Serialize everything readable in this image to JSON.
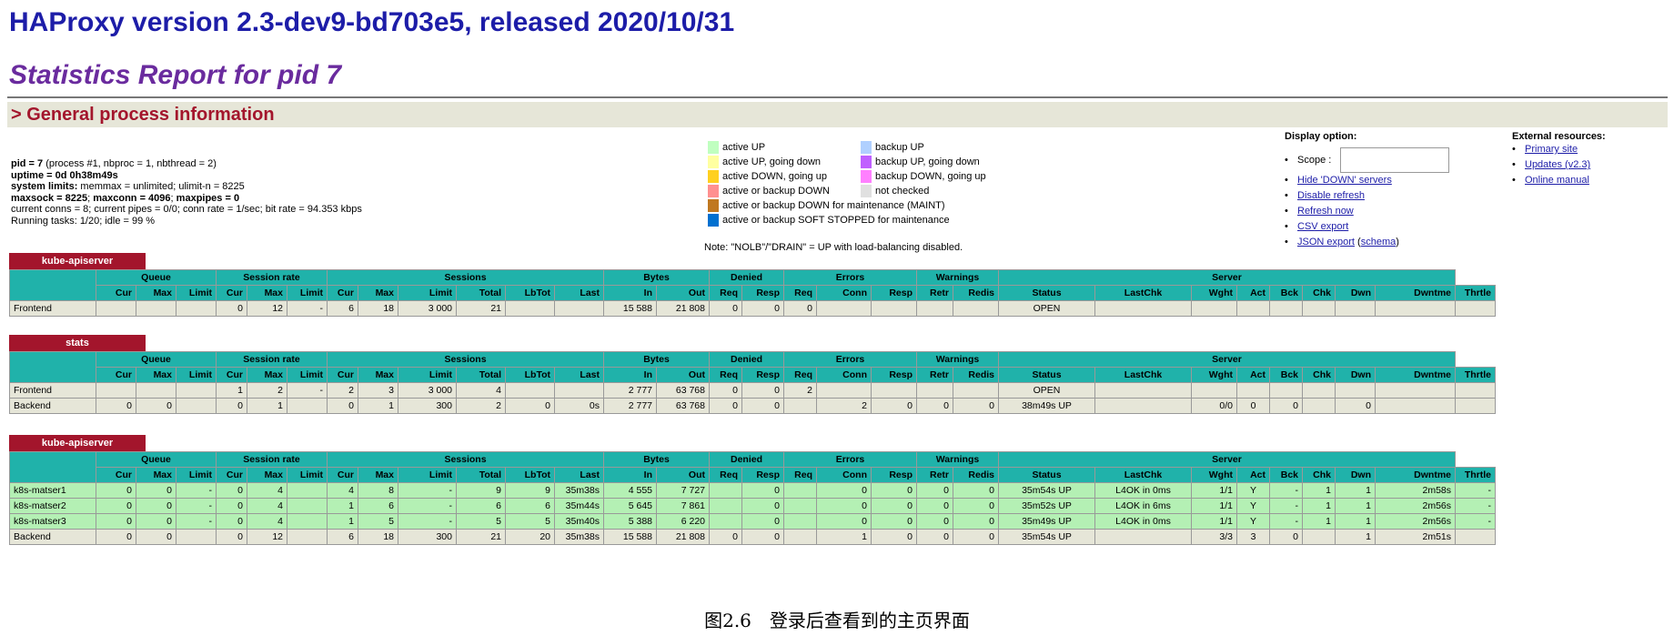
{
  "title": "HAProxy version 2.3-dev9-bd703e5, released 2020/10/31",
  "subtitle": "Statistics Report for pid 7",
  "section_title": "> General process information",
  "process_info": {
    "line1_key": "pid = 7",
    "line1_rest": " (process #1, nbproc = 1, nbthread = 2)",
    "line2_key": "uptime = 0d 0h38m49s",
    "line3_key": "system limits:",
    "line3_rest": " memmax = unlimited; ulimit-n = 8225",
    "line4_key1": "maxsock = 8225",
    "line4_sep1": "; ",
    "line4_key2": "maxconn = 4096",
    "line4_sep2": "; ",
    "line4_key3": "maxpipes = 0",
    "line5": "current conns = 8; current pipes = 0/0; conn rate = 1/sec; bit rate = 94.353 kbps",
    "line6": "Running tasks: 1/20; idle = 99 %"
  },
  "legend": {
    "left": [
      {
        "label": "active UP",
        "color": "#c0ffc0"
      },
      {
        "label": "active UP, going down",
        "color": "#ffffa0"
      },
      {
        "label": "active DOWN, going up",
        "color": "#ffd020"
      },
      {
        "label": "active or backup DOWN",
        "color": "#ff9090"
      },
      {
        "label": "active or backup DOWN for maintenance (MAINT)",
        "color": "#c07820"
      },
      {
        "label": "active or backup SOFT STOPPED for maintenance",
        "color": "#0070d0"
      }
    ],
    "right": [
      {
        "label": "backup UP",
        "color": "#b0d0ff"
      },
      {
        "label": "backup UP, going down",
        "color": "#c060ff"
      },
      {
        "label": "backup DOWN, going up",
        "color": "#ff80ff"
      },
      {
        "label": "not checked",
        "color": "#e0e0e0"
      }
    ],
    "note": "Note: \"NOLB\"/\"DRAIN\" = UP with load-balancing disabled."
  },
  "display_options": {
    "title": "Display option:",
    "scope_label": "Scope :",
    "links": [
      "Hide 'DOWN' servers",
      "Disable refresh",
      "Refresh now",
      "CSV export"
    ],
    "json_link": "JSON export",
    "schema_link": "schema"
  },
  "external": {
    "title": "External resources:",
    "links": [
      "Primary site",
      "Updates (v2.3)",
      "Online manual"
    ]
  },
  "headers": {
    "groups": [
      "Queue",
      "Session rate",
      "Sessions",
      "Bytes",
      "Denied",
      "Errors",
      "Warnings",
      "Server"
    ],
    "cols": [
      "Cur",
      "Max",
      "Limit",
      "Cur",
      "Max",
      "Limit",
      "Cur",
      "Max",
      "Limit",
      "Total",
      "LbTot",
      "Last",
      "In",
      "Out",
      "Req",
      "Resp",
      "Req",
      "Conn",
      "Resp",
      "Retr",
      "Redis",
      "Status",
      "LastChk",
      "Wght",
      "Act",
      "Bck",
      "Chk",
      "Dwn",
      "Dwntme",
      "Thrtle"
    ]
  },
  "proxies": [
    {
      "name": "kube-apiserver",
      "rows": [
        {
          "kind": "fe",
          "cells": [
            "Frontend",
            "",
            "",
            "",
            "0",
            "12",
            "-",
            "6",
            "18",
            "3 000",
            "21",
            "",
            "",
            "15 588",
            "21 808",
            "0",
            "0",
            "0",
            "",
            "",
            "",
            "",
            "OPEN",
            "",
            "",
            "",
            "",
            "",
            "",
            "",
            ""
          ]
        }
      ]
    },
    {
      "name": "stats",
      "rows": [
        {
          "kind": "fe",
          "cells": [
            "Frontend",
            "",
            "",
            "",
            "1",
            "2",
            "-",
            "2",
            "3",
            "3 000",
            "4",
            "",
            "",
            "2 777",
            "63 768",
            "0",
            "0",
            "2",
            "",
            "",
            "",
            "",
            "OPEN",
            "",
            "",
            "",
            "",
            "",
            "",
            "",
            ""
          ]
        },
        {
          "kind": "be",
          "cells": [
            "Backend",
            "0",
            "0",
            "",
            "0",
            "1",
            "",
            "0",
            "1",
            "300",
            "2",
            "0",
            "0s",
            "2 777",
            "63 768",
            "0",
            "0",
            "",
            "2",
            "0",
            "0",
            "0",
            "38m49s UP",
            "",
            "0/0",
            "0",
            "0",
            "",
            "0",
            "",
            ""
          ]
        }
      ]
    },
    {
      "name": "kube-apiserver",
      "rows": [
        {
          "kind": "up",
          "cells": [
            "k8s-matser1",
            "0",
            "0",
            "-",
            "0",
            "4",
            "",
            "4",
            "8",
            "-",
            "9",
            "9",
            "35m38s",
            "4 555",
            "7 727",
            "",
            "0",
            "",
            "0",
            "0",
            "0",
            "0",
            "35m54s UP",
            "L4OK in 0ms",
            "1/1",
            "Y",
            "-",
            "1",
            "1",
            "2m58s",
            "-"
          ]
        },
        {
          "kind": "up",
          "cells": [
            "k8s-matser2",
            "0",
            "0",
            "-",
            "0",
            "4",
            "",
            "1",
            "6",
            "-",
            "6",
            "6",
            "35m44s",
            "5 645",
            "7 861",
            "",
            "0",
            "",
            "0",
            "0",
            "0",
            "0",
            "35m52s UP",
            "L4OK in 6ms",
            "1/1",
            "Y",
            "-",
            "1",
            "1",
            "2m56s",
            "-"
          ]
        },
        {
          "kind": "up",
          "cells": [
            "k8s-matser3",
            "0",
            "0",
            "-",
            "0",
            "4",
            "",
            "1",
            "5",
            "-",
            "5",
            "5",
            "35m40s",
            "5 388",
            "6 220",
            "",
            "0",
            "",
            "0",
            "0",
            "0",
            "0",
            "35m49s UP",
            "L4OK in 0ms",
            "1/1",
            "Y",
            "-",
            "1",
            "1",
            "2m56s",
            "-"
          ]
        },
        {
          "kind": "be",
          "cells": [
            "Backend",
            "0",
            "0",
            "",
            "0",
            "12",
            "",
            "6",
            "18",
            "300",
            "21",
            "20",
            "35m38s",
            "15 588",
            "21 808",
            "0",
            "0",
            "",
            "1",
            "0",
            "0",
            "0",
            "35m54s UP",
            "",
            "3/3",
            "3",
            "0",
            "",
            "1",
            "2m51s",
            ""
          ]
        }
      ]
    }
  ],
  "caption": "图2.6　登录后查看到的主页界面"
}
